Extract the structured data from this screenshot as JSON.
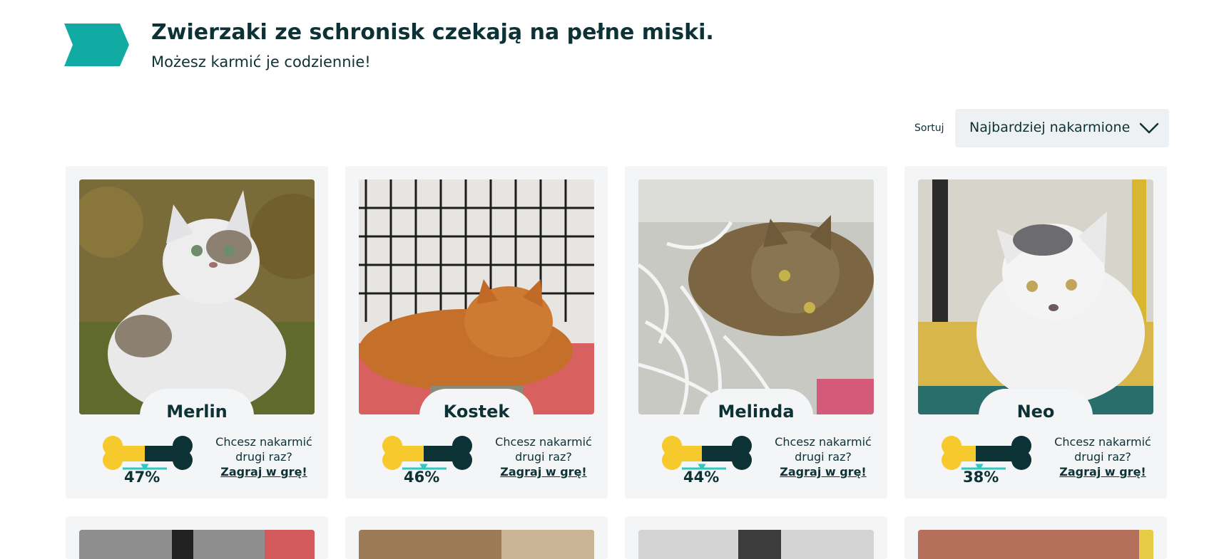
{
  "header": {
    "title": "Zwierzaki ze schronisk czekają na pełne miski.",
    "subtitle": "Możesz karmić je codziennie!",
    "accent_color": "#12aba4"
  },
  "sort": {
    "label": "Sortuj",
    "selected": "Najbardziej nakarmione"
  },
  "colors": {
    "bone_fill": "#f6c92d",
    "bone_empty": "#0d3236",
    "card_bg": "#f3f5f7",
    "text": "#0d3236"
  },
  "pets": [
    {
      "name": "Merlin",
      "percent": "47%",
      "fill": 0.47,
      "cta_question": "Chcesz nakarmić drugi raz?",
      "cta_link": "Zagraj w grę!"
    },
    {
      "name": "Kostek",
      "percent": "46%",
      "fill": 0.46,
      "cta_question": "Chcesz nakarmić drugi raz?",
      "cta_link": "Zagraj w grę!"
    },
    {
      "name": "Melinda",
      "percent": "44%",
      "fill": 0.44,
      "cta_question": "Chcesz nakarmić drugi raz?",
      "cta_link": "Zagraj w grę!"
    },
    {
      "name": "Neo",
      "percent": "38%",
      "fill": 0.38,
      "cta_question": "Chcesz nakarmić drugi raz?",
      "cta_link": "Zagraj w grę!"
    }
  ]
}
